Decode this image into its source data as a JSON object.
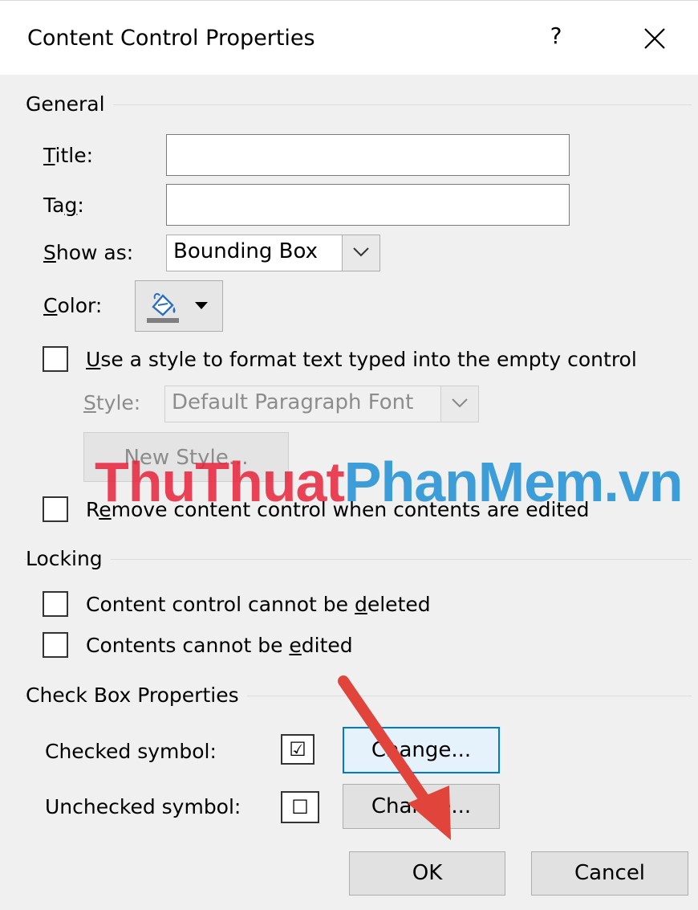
{
  "dialog": {
    "title": "Content Control Properties",
    "help_label": "?",
    "close_label": "✕"
  },
  "general": {
    "heading": "General",
    "title_label": "Title:",
    "title_value": "",
    "tag_label": "Tag:",
    "tag_value": "",
    "show_as_label": "Show as:",
    "show_as_value": "Bounding Box",
    "color_label": "Color:",
    "color_icon": "paint-bucket-icon",
    "use_style_label": "Use a style to format text typed into the empty control",
    "use_style_checked": false,
    "style_label": "Style:",
    "style_value": "Default Paragraph Font",
    "new_style_label": "New Style...",
    "remove_label": "Remove content control when contents are edited",
    "remove_checked": false
  },
  "locking": {
    "heading": "Locking",
    "cannot_delete_label": "Content control cannot be deleted",
    "cannot_delete_checked": false,
    "cannot_edit_label": "Contents cannot be edited",
    "cannot_edit_checked": false
  },
  "checkbox_props": {
    "heading": "Check Box Properties",
    "checked_label": "Checked symbol:",
    "checked_symbol": "☑",
    "unchecked_label": "Unchecked symbol:",
    "unchecked_symbol": "☐",
    "change_label": "Change...",
    "change2_label": "Change..."
  },
  "footer": {
    "ok_label": "OK",
    "cancel_label": "Cancel"
  },
  "watermark": {
    "part1": "ThuThuat",
    "part2": "PhanMem",
    "part3": ".vn"
  },
  "colors": {
    "focus_blue": "#0078d7",
    "arrow_red": "#e0443a",
    "watermark_red": "#e8233a",
    "watermark_blue": "#1e8fd5"
  }
}
